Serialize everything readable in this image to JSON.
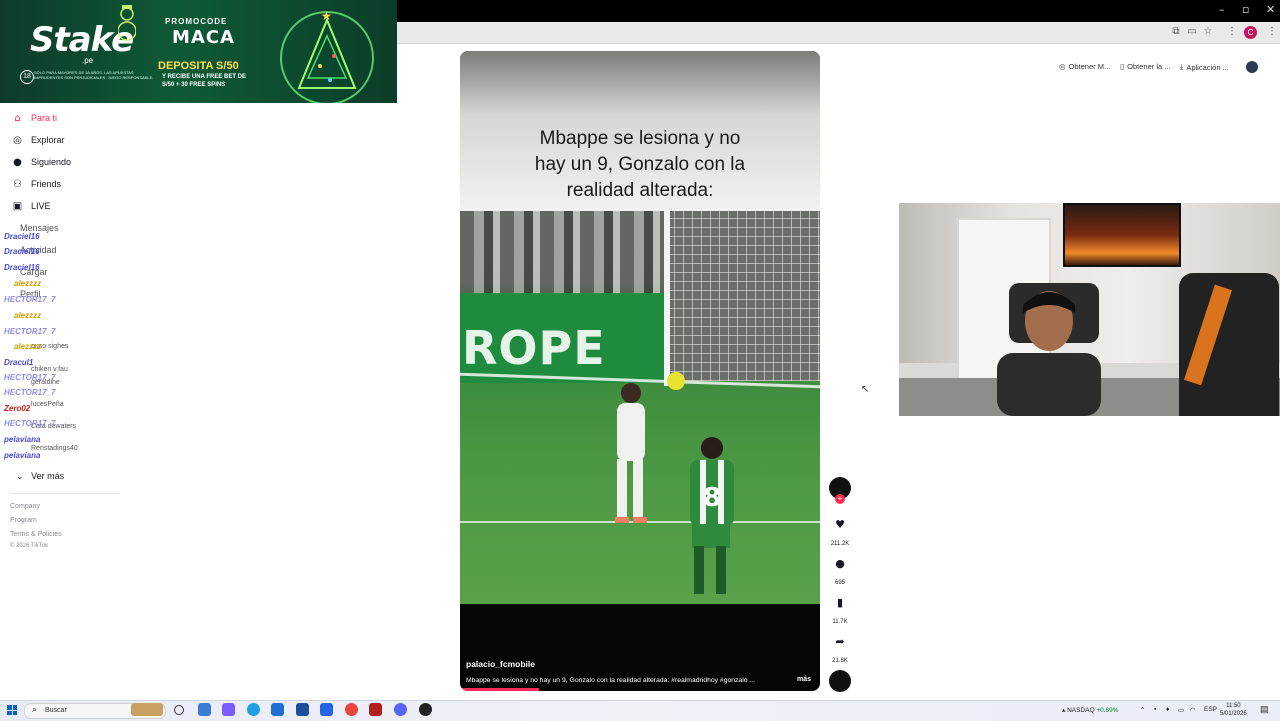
{
  "banner": {
    "brand": "Stake",
    "brand_sub": ".pe",
    "promo_label": "PROMOCODE",
    "promo_code": "MACA",
    "deposit": "DEPOSITA S/50",
    "deposit_sub": "Y RECIBE UNA FREE BET DE",
    "deposit_sub2": "S/50 + 30 FREE SPINS",
    "age": "18",
    "age_text": "SÓLO PARA MAYORES DE 18 AÑOS. LAS APUESTAS IMPRUDENTES SON PERJUDICIALES. JUEGO RESPONSABLE."
  },
  "sidebar": {
    "items": [
      {
        "label": "Para ti",
        "icon": "home-icon"
      },
      {
        "label": "Explorar",
        "icon": "compass-icon"
      },
      {
        "label": "Siguiendo",
        "icon": "following-avatar-icon"
      },
      {
        "label": "Friends",
        "icon": "friends-icon"
      },
      {
        "label": "LIVE",
        "icon": "live-icon"
      },
      {
        "label": "Mensajes",
        "icon": "message-icon"
      },
      {
        "label": "Actividad",
        "icon": "activity-icon"
      },
      {
        "label": "Cargar",
        "icon": "upload-icon"
      },
      {
        "label": "Perfil",
        "icon": "profile-icon"
      }
    ],
    "following": [
      {
        "name": "ouso sighes"
      },
      {
        "name": "chiken v.fau"
      },
      {
        "name": "geraldine"
      },
      {
        "name": "lucesPeña"
      },
      {
        "name": "Cata dewaters"
      },
      {
        "name": "Renstadings40"
      }
    ],
    "ver_mas": "Ver más",
    "footer": [
      "Company",
      "Program",
      "Terms & Policies",
      "© 2026 TikTok"
    ]
  },
  "chat_overlay": [
    {
      "user": "Draciel16",
      "color": "#4a4ad6"
    },
    {
      "user": "Draciel16",
      "color": "#4a4ad6"
    },
    {
      "user": "Draciel16",
      "color": "#4a4ad6"
    },
    {
      "user": "alezzzz",
      "color": "#d0a000"
    },
    {
      "user": "HECTOR17_7",
      "color": "#8e8ee8"
    },
    {
      "user": "alezzzz",
      "color": "#d0a000"
    },
    {
      "user": "HECTOR17_7",
      "color": "#8e8ee8"
    },
    {
      "user": "alezzzz",
      "color": "#d0a000"
    },
    {
      "user": "Dracul1",
      "color": "#4a4ad6"
    },
    {
      "user": "HECTOR17_7",
      "color": "#8e8ee8"
    },
    {
      "user": "HECTOR17_7",
      "color": "#8e8ee8"
    },
    {
      "user": "Zero02",
      "color": "#c02020"
    },
    {
      "user": "HECTOR17_7",
      "color": "#8e8ee8"
    },
    {
      "user": "pelaviana",
      "color": "#4a4ad6"
    },
    {
      "user": "pelaviana",
      "color": "#4a4ad6"
    }
  ],
  "top_buttons": [
    {
      "label": "Obtener M...",
      "icon": "coin-icon"
    },
    {
      "label": "Obtener la ...",
      "icon": "phone-icon"
    },
    {
      "label": "Aplicación ...",
      "icon": "download-icon"
    }
  ],
  "video": {
    "caption_lines": [
      "Mbappe se lesiona y no",
      "hay un 9, Gonzalo con la",
      "realidad alterada:"
    ],
    "board_text": "ROPE",
    "jersey_number": "8",
    "author": "palacio_fcmobile",
    "description": "Mbappe se lesiona y no hay un 9, Gonzalo con la realidad alterada: #realmadridhoy #gonzalo ...",
    "more": "más",
    "progress": 0.22
  },
  "actions": {
    "likes": "211.2K",
    "comments": "695",
    "saves": "11.7K",
    "shares": "21.8K"
  },
  "taskbar": {
    "search_placeholder": "Buscar",
    "stock_name": "NASDAQ",
    "stock_change": "+0.89%",
    "lang": "ESP",
    "time": "11:50",
    "date": "5/01/2026"
  },
  "colors": {
    "accent": "#fe2c55",
    "stake_green": "#0f5a36",
    "board_green": "#1f8b3e"
  }
}
